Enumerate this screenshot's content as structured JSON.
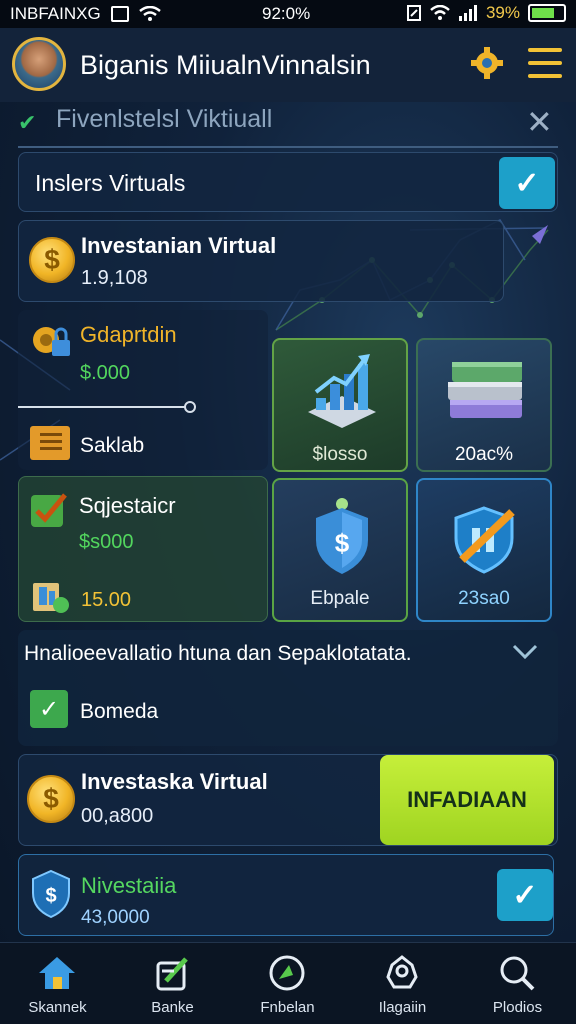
{
  "status_bar": {
    "left_text": "INBFAINXG",
    "time": "92:0%",
    "battery": "39%"
  },
  "header": {
    "title": "Biganis MiiualnVinnalsin"
  },
  "subheader": {
    "title": "Fivenlstelsl Viktiuall"
  },
  "insiders": {
    "title": "Inslers Virtuals",
    "checked": true
  },
  "investment_card": {
    "title": "Investanian Virtual",
    "value": "1.9,108"
  },
  "left_panel": {
    "item1_label": "Gdaprtdin",
    "item1_value": "$.000",
    "item2_label": "Saklab"
  },
  "tiles": [
    {
      "label": "$losso",
      "icon": "chart-icon"
    },
    {
      "label": "20ac%",
      "icon": "books-icon"
    },
    {
      "label": "Ebpale",
      "icon": "shield-dollar-icon"
    },
    {
      "label": "23sa0",
      "icon": "shield-pen-icon"
    }
  ],
  "suggest_panel": {
    "title": "Sqjestaicr",
    "value1": "$s000",
    "value2": "15.00"
  },
  "info": {
    "text": "Hnalioeevallatio htuna dan Sepaklotatata.",
    "check_label": "Bomeda"
  },
  "invest_row": {
    "title": "Investaska Virtual",
    "value": "00,a800",
    "button": "INFADIAAN"
  },
  "investor_row": {
    "title": "Nivestaiia",
    "value": "43,0000",
    "checked": true
  },
  "nav": [
    {
      "label": "Skannek",
      "icon": "home-icon"
    },
    {
      "label": "Banke",
      "icon": "edit-icon"
    },
    {
      "label": "Fnbelan",
      "icon": "globe-icon"
    },
    {
      "label": "Ilagaiin",
      "icon": "profile-icon"
    },
    {
      "label": "Plodios",
      "icon": "search-icon"
    }
  ],
  "colors": {
    "accent_green": "#b6e02a",
    "accent_cyan": "#1da0c9",
    "gold": "#f1b526",
    "text_green": "#52d65e"
  }
}
